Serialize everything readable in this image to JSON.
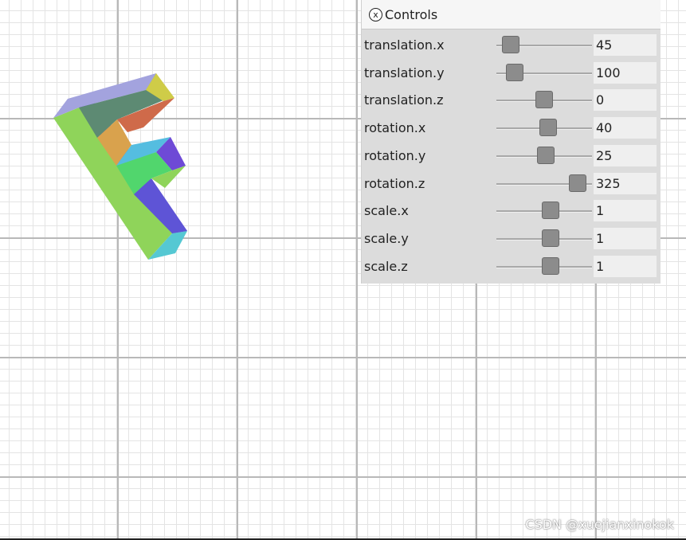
{
  "panel": {
    "close_icon": "x-circle-icon",
    "close_glyph": "x",
    "title": "Controls"
  },
  "controls": [
    {
      "label": "translation.x",
      "value": "45",
      "level": 0.15
    },
    {
      "label": "translation.y",
      "value": "100",
      "level": 0.19
    },
    {
      "label": "translation.z",
      "value": "0",
      "level": 0.5
    },
    {
      "label": "rotation.x",
      "value": "40",
      "level": 0.54
    },
    {
      "label": "rotation.y",
      "value": "25",
      "level": 0.52
    },
    {
      "label": "rotation.z",
      "value": "325",
      "level": 0.85
    },
    {
      "label": "scale.x",
      "value": "1",
      "level": 0.57
    },
    {
      "label": "scale.y",
      "value": "1",
      "level": 0.57
    },
    {
      "label": "scale.z",
      "value": "1",
      "level": 0.57
    }
  ],
  "scene": {
    "shape": "letter-f-3d",
    "face_colors": [
      "#8fd45a",
      "#5e54d6",
      "#55c8d3",
      "#a3a3de",
      "#5d8a73",
      "#cfcc48",
      "#cf6a4a",
      "#d9a24d",
      "#55bde0",
      "#6e4ad6",
      "#51d66d"
    ]
  },
  "watermark": "CSDN @xuejianxinokok"
}
